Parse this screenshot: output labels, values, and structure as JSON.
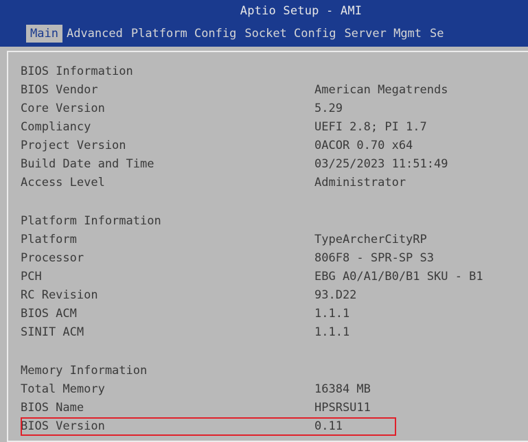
{
  "header": {
    "title": "Aptio Setup - AMI",
    "tabs": [
      "Main",
      "Advanced",
      "Platform Config",
      "Socket Config",
      "Server Mgmt",
      "Se"
    ]
  },
  "sections": [
    {
      "heading": "BIOS Information",
      "rows": [
        {
          "label": "BIOS Vendor",
          "value": "American Megatrends"
        },
        {
          "label": "Core Version",
          "value": "5.29"
        },
        {
          "label": "Compliancy",
          "value": "UEFI 2.8; PI 1.7"
        },
        {
          "label": "Project Version",
          "value": "0ACOR 0.70 x64"
        },
        {
          "label": "Build Date and Time",
          "value": "03/25/2023 11:51:49"
        },
        {
          "label": "Access Level",
          "value": "Administrator"
        }
      ]
    },
    {
      "heading": "Platform Information",
      "rows": [
        {
          "label": "Platform",
          "value": "TypeArcherCityRP"
        },
        {
          "label": "Processor",
          "value": "806F8 - SPR-SP S3"
        },
        {
          "label": "PCH",
          "value": "EBG A0/A1/B0/B1 SKU - B1"
        },
        {
          "label": "RC Revision",
          "value": "93.D22"
        },
        {
          "label": "BIOS ACM",
          "value": "1.1.1"
        },
        {
          "label": "SINIT ACM",
          "value": "1.1.1"
        }
      ]
    },
    {
      "heading": "Memory Information",
      "rows": [
        {
          "label": "Total Memory",
          "value": "16384 MB"
        },
        {
          "label": "BIOS Name",
          "value": "HPSRSU11"
        },
        {
          "label": "BIOS Version",
          "value": "0.11"
        }
      ]
    }
  ],
  "colors": {
    "header_bg": "#1a3a8e",
    "panel_bg": "#b9b9b9",
    "highlight": "#e0202a"
  }
}
